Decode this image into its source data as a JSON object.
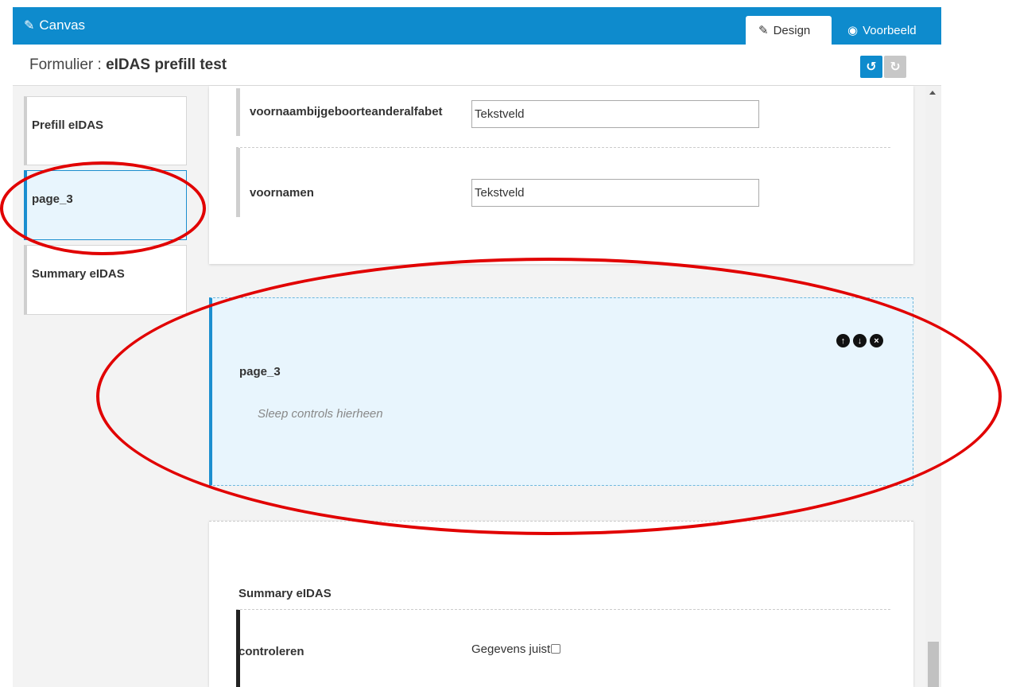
{
  "topbar": {
    "app_icon": "edit-icon",
    "app_title": "Canvas",
    "tabs": [
      {
        "label": "Design",
        "icon": "edit-icon",
        "active": true
      },
      {
        "label": "Voorbeeld",
        "icon": "eye-icon",
        "active": false
      }
    ]
  },
  "form": {
    "prefix": "Formulier : ",
    "name": "eIDAS prefill test",
    "undo_icon": "undo-icon",
    "redo_icon": "redo-icon"
  },
  "pages": [
    {
      "label": "Prefill eIDAS",
      "selected": false
    },
    {
      "label": "page_3",
      "selected": true
    },
    {
      "label": "Summary eIDAS",
      "selected": false
    }
  ],
  "card1": {
    "fields": [
      {
        "name": "voornaambijgeboorteanderalfabet",
        "value": "Tekstveld"
      },
      {
        "name": "voornamen",
        "value": "Tekstveld"
      }
    ]
  },
  "selected_page": {
    "title": "page_3",
    "hint": "Sleep controls hierheen",
    "icons": [
      "arrow-up-icon",
      "arrow-down-icon",
      "close-icon"
    ]
  },
  "summary_page": {
    "title": "Summary eIDAS",
    "field_name": "controleren",
    "field_value": "Gegevens juist",
    "checked": false
  },
  "annotation_color": "#e10000",
  "accent_color": "#0e8bcd"
}
